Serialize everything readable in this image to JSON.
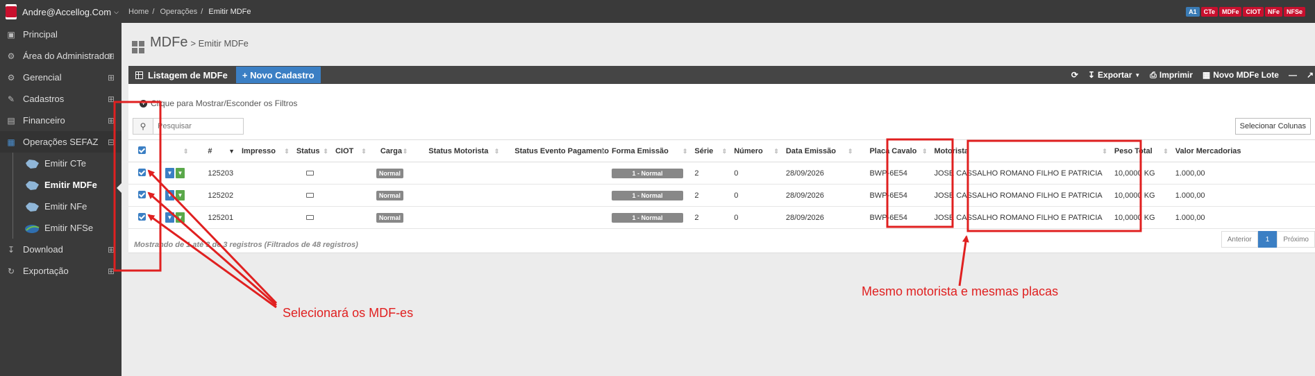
{
  "user": {
    "name": "Andre@Accellog.Com"
  },
  "sidebar": {
    "items": [
      {
        "label": "Principal",
        "icon": "laptop-icon"
      },
      {
        "label": "Área do Administrador",
        "icon": "cogs-icon"
      },
      {
        "label": "Gerencial",
        "icon": "cogs-icon"
      },
      {
        "label": "Cadastros",
        "icon": "edit-icon"
      },
      {
        "label": "Financeiro",
        "icon": "money-icon"
      },
      {
        "label": "Operações SEFAZ",
        "icon": "windows-icon"
      }
    ],
    "sub_items": [
      {
        "label": "Emitir CTe"
      },
      {
        "label": "Emitir MDFe"
      },
      {
        "label": "Emitir NFe"
      },
      {
        "label": "Emitir NFSe"
      }
    ],
    "bottom_items": [
      {
        "label": "Download",
        "icon": "download-icon"
      },
      {
        "label": "Exportação",
        "icon": "share-icon"
      }
    ]
  },
  "breadcrumb": [
    "Home",
    "Operações",
    "Emitir MDFe"
  ],
  "badges": [
    "A1",
    "CTe",
    "MDFe",
    "CIOT",
    "NFe",
    "NFSe"
  ],
  "page": {
    "title": "MDFe",
    "subtitle": "> Emitir MDFe"
  },
  "panel": {
    "title": "Listagem de MDFe",
    "new_button": "+ Novo Cadastro",
    "actions": {
      "exportar": "Exportar",
      "imprimir": "Imprimir",
      "lote": "Novo MDFe Lote"
    },
    "filter_toggle": "Clique para Mostrar/Esconder os Filtros",
    "search_placeholder": "Pesquisar",
    "select_columns": "Selecionar Colunas"
  },
  "table": {
    "headers": [
      "#",
      "Impresso",
      "Status",
      "CIOT",
      "Carga",
      "Status Motorista",
      "Status Evento Pagamento",
      "Forma Emissão",
      "Série",
      "Número",
      "Data Emissão",
      "Placa Cavalo",
      "Motorista",
      "Peso Total",
      "Valor Mercadorias"
    ],
    "rows": [
      {
        "id": "125203",
        "carga": "Normal",
        "forma": "1 - Normal",
        "serie": "2",
        "numero": "0",
        "data": "28/09/2026",
        "placa": "BWP-6E54",
        "motorista": "JOSE CASSALHO ROMANO FILHO E PATRICIA",
        "peso": "10,0000 KG",
        "valor": "1.000,00"
      },
      {
        "id": "125202",
        "carga": "Normal",
        "forma": "1 - Normal",
        "serie": "2",
        "numero": "0",
        "data": "28/09/2026",
        "placa": "BWP-6E54",
        "motorista": "JOSE CASSALHO ROMANO FILHO E PATRICIA",
        "peso": "10,0000 KG",
        "valor": "1.000,00"
      },
      {
        "id": "125201",
        "carga": "Normal",
        "forma": "1 - Normal",
        "serie": "2",
        "numero": "0",
        "data": "28/09/2026",
        "placa": "BWP-6E54",
        "motorista": "JOSE CASSALHO ROMANO FILHO E PATRICIA",
        "peso": "10,0000 KG",
        "valor": "1.000,00"
      }
    ],
    "footer": "Mostrando de 1 até 3 de 3 registros (Filtrados de 48 registros)"
  },
  "pager": {
    "prev": "Anterior",
    "page": "1",
    "next": "Próximo"
  },
  "annotations": {
    "left_text": "Selecionará os MDF-es",
    "right_text": "Mesmo motorista e mesmas placas",
    "color": "#e02020"
  }
}
